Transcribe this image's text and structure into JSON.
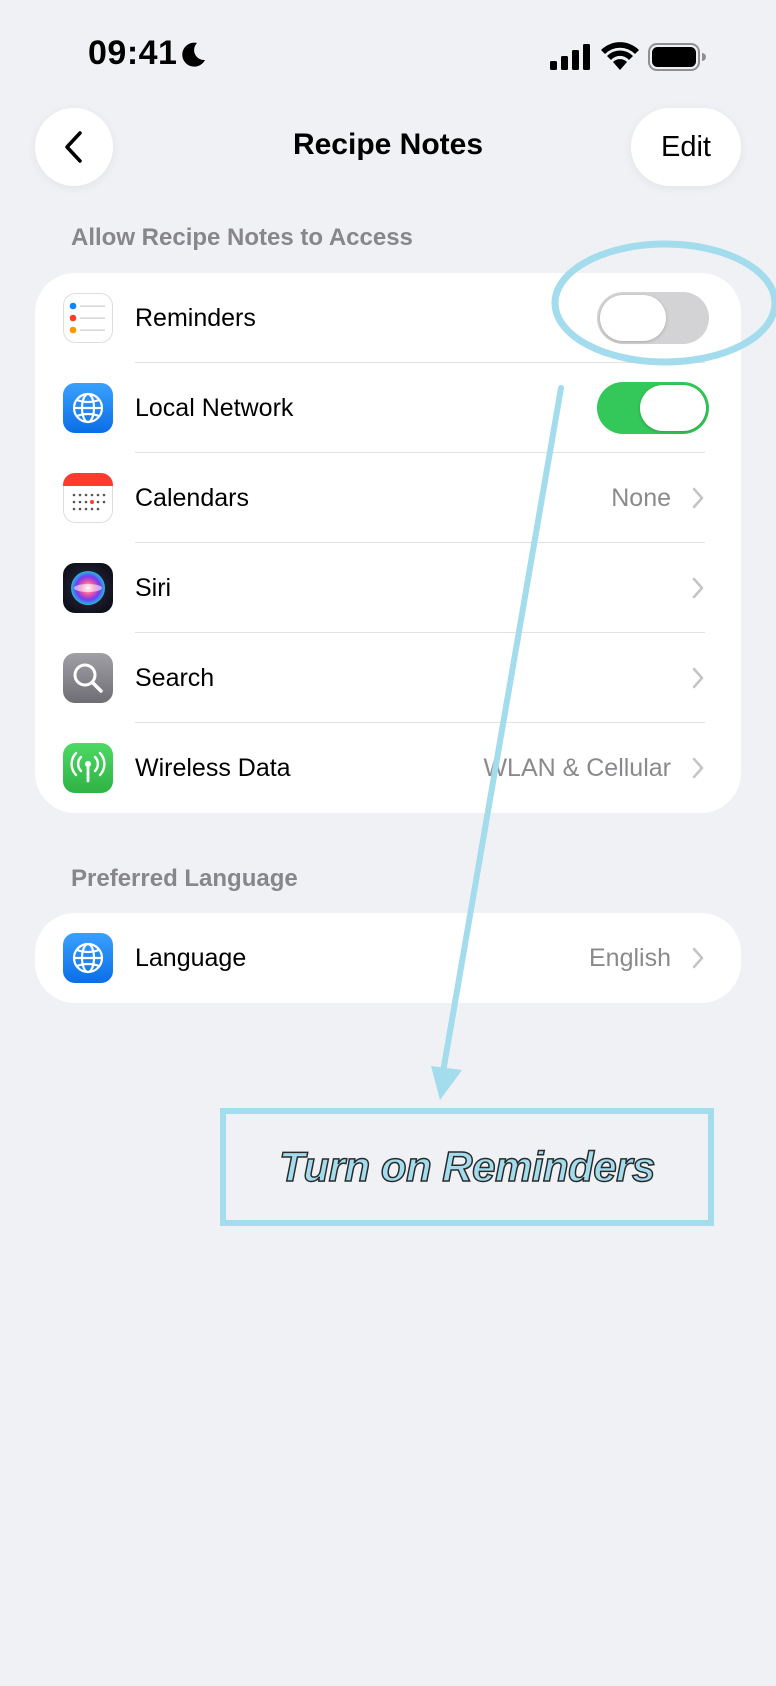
{
  "status_bar": {
    "time": "09:41"
  },
  "nav": {
    "title": "Recipe Notes",
    "edit_label": "Edit"
  },
  "sections": [
    {
      "header": "Allow Recipe Notes to Access",
      "rows": [
        {
          "label": "Reminders",
          "type": "toggle",
          "state": "off",
          "icon": "reminders-icon"
        },
        {
          "label": "Local Network",
          "type": "toggle",
          "state": "on",
          "icon": "globe-icon"
        },
        {
          "label": "Calendars",
          "type": "link",
          "value": "None",
          "icon": "calendar-icon"
        },
        {
          "label": "Siri",
          "type": "link",
          "value": "",
          "icon": "siri-icon"
        },
        {
          "label": "Search",
          "type": "link",
          "value": "",
          "icon": "search-icon"
        },
        {
          "label": "Wireless Data",
          "type": "link",
          "value": "WLAN & Cellular",
          "icon": "antenna-icon"
        }
      ]
    },
    {
      "header": "Preferred Language",
      "rows": [
        {
          "label": "Language",
          "type": "link",
          "value": "English",
          "icon": "globe-icon"
        }
      ]
    }
  ],
  "annotation": {
    "text": "Turn on Reminders",
    "color": "#a3dcec"
  },
  "colors": {
    "toggle_on": "#34c759",
    "toggle_off": "#d3d3d6",
    "background": "#f0f1f5"
  }
}
